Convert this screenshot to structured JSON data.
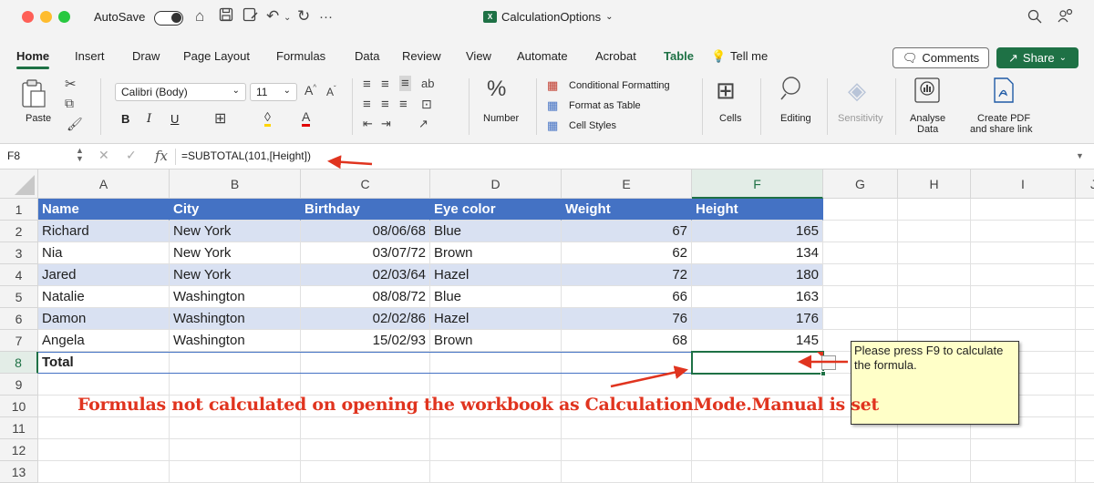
{
  "titlebar": {
    "autosave": "AutoSave",
    "doc_title": "CalculationOptions",
    "app_badge": "X"
  },
  "tabs": [
    "Home",
    "Insert",
    "Draw",
    "Page Layout",
    "Formulas",
    "Data",
    "Review",
    "View",
    "Automate",
    "Acrobat",
    "Table"
  ],
  "tellme": "Tell me",
  "buttons": {
    "comments": "Comments",
    "share": "Share"
  },
  "ribbon": {
    "paste": "Paste",
    "font_name": "Calibri (Body)",
    "font_size": "11",
    "number": "Number",
    "conditional_formatting": "Conditional Formatting",
    "format_as_table": "Format as Table",
    "cell_styles": "Cell Styles",
    "cells": "Cells",
    "editing": "Editing",
    "sensitivity": "Sensitivity",
    "analyse_data_1": "Analyse",
    "analyse_data_2": "Data",
    "create_pdf_1": "Create PDF",
    "create_pdf_2": "and share link",
    "bold": "B",
    "italic": "I",
    "underline": "U"
  },
  "formula_bar": {
    "name_box": "F8",
    "formula": "=SUBTOTAL(101,[Height])"
  },
  "columns": [
    "A",
    "B",
    "C",
    "D",
    "E",
    "F",
    "G",
    "H",
    "I",
    "J"
  ],
  "rows": [
    "1",
    "2",
    "3",
    "4",
    "5",
    "6",
    "7",
    "8",
    "9",
    "10",
    "11",
    "12",
    "13"
  ],
  "table": {
    "headers": [
      "Name",
      "City",
      "Birthday",
      "Eye color",
      "Weight",
      "Height"
    ],
    "data": [
      [
        "Richard",
        "New York",
        "08/06/68",
        "Blue",
        "67",
        "165"
      ],
      [
        "Nia",
        "New York",
        "03/07/72",
        "Brown",
        "62",
        "134"
      ],
      [
        "Jared",
        "New York",
        "02/03/64",
        "Hazel",
        "72",
        "180"
      ],
      [
        "Natalie",
        "Washington",
        "08/08/72",
        "Blue",
        "66",
        "163"
      ],
      [
        "Damon",
        "Washington",
        "02/02/86",
        "Hazel",
        "76",
        "176"
      ],
      [
        "Angela",
        "Washington",
        "15/02/93",
        "Brown",
        "68",
        "145"
      ]
    ],
    "total_label": "Total"
  },
  "note": "Please press F9 to calculate the formula.",
  "message": "Formulas not calculated on opening the workbook as CalculationMode.Manual is set",
  "colors": {
    "accent": "#1e7145",
    "table_header": "#4472c4",
    "band": "#d9e1f2",
    "annotation": "#e0341f"
  }
}
